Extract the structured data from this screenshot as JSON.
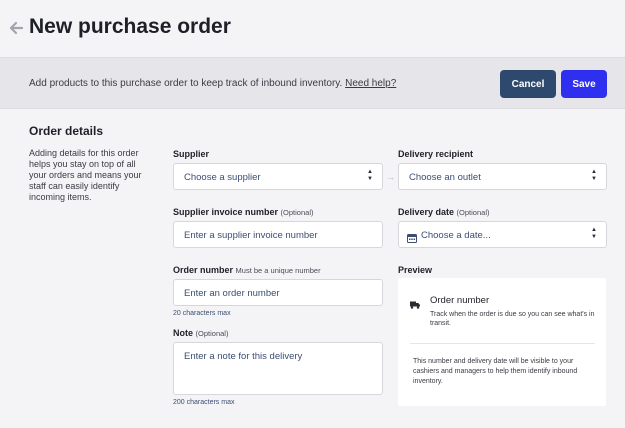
{
  "header": {
    "title": "New purchase order"
  },
  "info_bar": {
    "text": "Add products to this purchase order to keep track of inbound inventory.",
    "help_link": "Need help?",
    "cancel_label": "Cancel",
    "save_label": "Save"
  },
  "order_details": {
    "title": "Order details",
    "description": "Adding details for this order helps you stay on top of all your orders and means your staff can easily identify incoming items."
  },
  "form": {
    "supplier": {
      "label": "Supplier",
      "value": "Choose a supplier"
    },
    "delivery_recipient": {
      "label": "Delivery recipient",
      "value": "Choose an outlet"
    },
    "supplier_invoice": {
      "label": "Supplier invoice number",
      "optional": "(Optional)",
      "placeholder": "Enter a supplier invoice number"
    },
    "delivery_date": {
      "label": "Delivery date",
      "optional": "(Optional)",
      "value": "Choose a date..."
    },
    "order_number": {
      "label": "Order number",
      "note": "Must be a unique number",
      "placeholder": "Enter an order number",
      "hint": "20 characters max"
    },
    "note": {
      "label": "Note",
      "optional": "(Optional)",
      "placeholder": "Enter a note for this delivery",
      "hint": "200 characters max"
    }
  },
  "preview": {
    "label": "Preview",
    "title": "Order number",
    "subtitle": "Track when the order is due so you can see what's in transit.",
    "footer": "This number and delivery date will be visible to your cashiers and managers to help them identify inbound inventory."
  },
  "icons": {
    "back": "arrow-left-icon",
    "select": "chevron-up-down-icon",
    "calendar": "calendar-icon",
    "truck": "truck-icon"
  }
}
